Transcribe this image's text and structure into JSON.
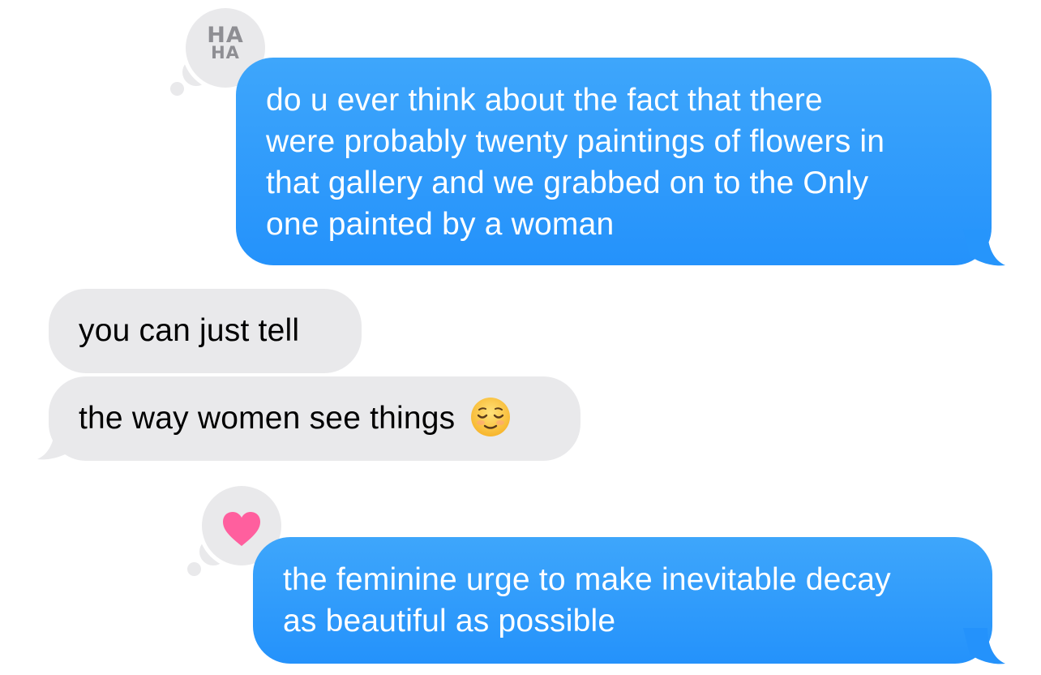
{
  "messages": [
    {
      "direction": "sent",
      "lines": [
        "do u ever think about the fact that there",
        "were probably twenty paintings of flowers in",
        "that gallery and we grabbed on to the Only",
        "one painted by a woman"
      ],
      "tapback": {
        "label_top": "HA",
        "label_bottom": "HA",
        "icon": "haha-icon"
      }
    },
    {
      "direction": "received",
      "lines": [
        "you can just tell"
      ]
    },
    {
      "direction": "received",
      "lines": [
        "the way women see things"
      ],
      "emoji": "relieved-face-icon"
    },
    {
      "direction": "sent",
      "lines": [
        "the feminine urge to make inevitable decay",
        "as beautiful as possible"
      ],
      "tapback": {
        "icon": "heart-icon"
      }
    }
  ],
  "colors": {
    "sent_bubble_top": "#3ea6fb",
    "sent_bubble_bottom": "#2492fb",
    "received_bubble": "#e9e9eb",
    "tapback_background": "#e9e9eb",
    "haha_text": "#8e8e93",
    "heart": "#ff5f9e",
    "emoji_face": "#ffcc3a"
  }
}
